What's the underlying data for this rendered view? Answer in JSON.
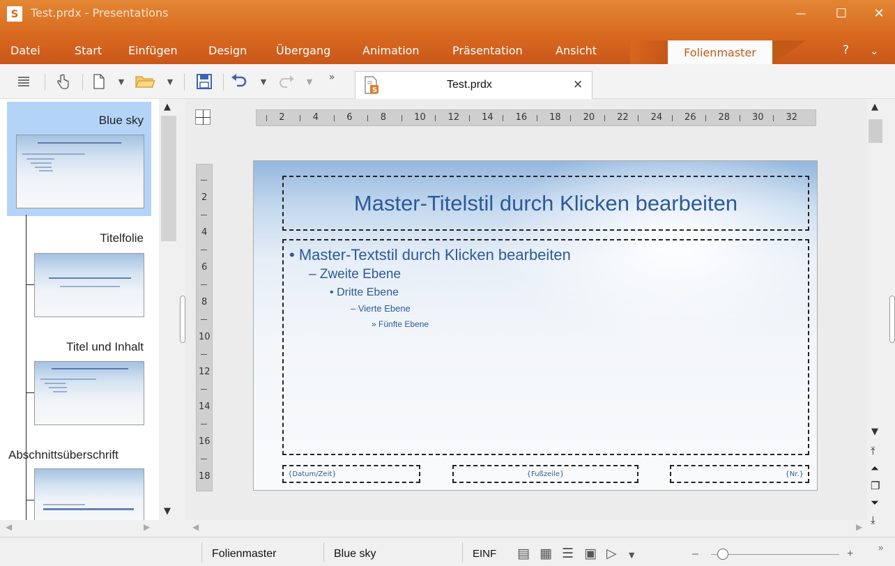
{
  "window": {
    "app_icon": "S",
    "title": "Test.prdx - Presentations",
    "minimize": "—",
    "maximize": "☐",
    "close": "✕"
  },
  "menu": {
    "items": [
      "Datei",
      "Start",
      "Einfügen",
      "Design",
      "Übergang",
      "Animation",
      "Präsentation",
      "Ansicht"
    ],
    "context_tab": "Folienmaster",
    "help": "?",
    "collapse": "⌄"
  },
  "toolbar": {
    "overflow": "»",
    "icons": [
      "menu-icon",
      "hand-pointer-icon",
      "new-document-icon",
      "open-folder-icon",
      "save-icon",
      "undo-icon",
      "redo-icon"
    ]
  },
  "document_tab": {
    "label": "Test.prdx",
    "close": "×"
  },
  "left_panel": {
    "layouts": [
      {
        "name": "Blue sky"
      },
      {
        "name": "Titelfolie"
      },
      {
        "name": "Titel und Inhalt"
      },
      {
        "name": "Abschnittsüberschrift"
      }
    ]
  },
  "ruler": {
    "h_ticks": [
      "2",
      "4",
      "6",
      "8",
      "10",
      "12",
      "14",
      "16",
      "18",
      "20",
      "22",
      "24",
      "26",
      "28",
      "30",
      "32"
    ],
    "v_ticks": [
      "2",
      "4",
      "6",
      "8",
      "10",
      "12",
      "14",
      "16",
      "18"
    ]
  },
  "slide": {
    "title": "Master-Titelstil durch Klicken bearbeiten",
    "levels": [
      "Master-Textstil durch Klicken bearbeiten",
      "Zweite Ebene",
      "Dritte Ebene",
      "Vierte Ebene",
      "Fünfte Ebene"
    ],
    "bullets": [
      "•",
      "–",
      "•",
      "–",
      "»"
    ],
    "footer_date": "{Datum/Zeit}",
    "footer_text": "{Fußzeile}",
    "footer_num": "{Nr.}"
  },
  "statusbar": {
    "mode": "Folienmaster",
    "master": "Blue sky",
    "insert": "EINF",
    "zoom_minus": "–",
    "zoom_plus": "+",
    "overflow": "»",
    "zoom_position": 0.09
  }
}
